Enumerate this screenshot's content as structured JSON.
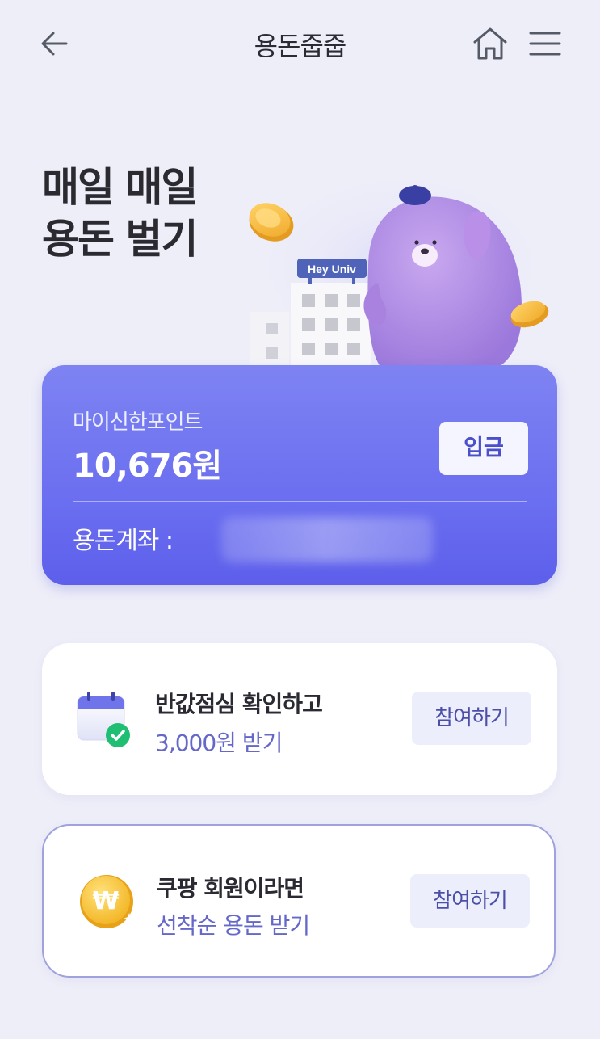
{
  "header": {
    "title": "용돈줍줍",
    "back_icon": "arrow-left-icon",
    "home_icon": "home-icon",
    "menu_icon": "hamburger-menu-icon"
  },
  "hero": {
    "line1": "매일 매일",
    "line2": "용돈 벌기",
    "sign_text": "Hey Univ"
  },
  "point_card": {
    "label": "마이신한포인트",
    "value": "10,676원",
    "deposit_label": "입금",
    "account_label": "용돈계좌 :"
  },
  "missions": [
    {
      "icon": "calendar-check-icon",
      "title": "반값점심 확인하고",
      "subtitle": "3,000원 받기",
      "button_label": "참여하기"
    },
    {
      "icon": "won-coin-icon",
      "title": "쿠팡 회원이라면",
      "subtitle": "선착순 용돈 받기",
      "button_label": "참여하기"
    }
  ],
  "colors": {
    "background": "#eeeef9",
    "card_primary": "#6b6ff0",
    "accent_text": "#6568c9",
    "button_bg": "#eceefb"
  }
}
